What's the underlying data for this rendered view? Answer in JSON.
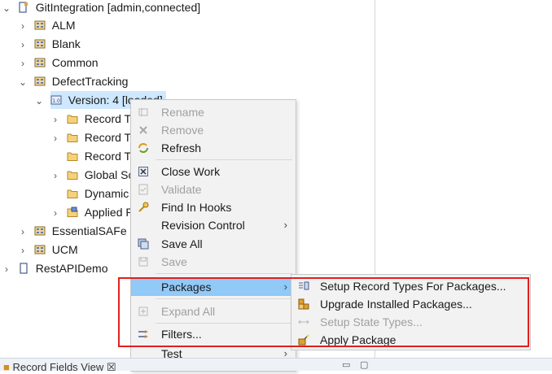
{
  "tree": {
    "root": {
      "label": "GitIntegration [admin,connected]"
    },
    "items": [
      {
        "label": "ALM"
      },
      {
        "label": "Blank"
      },
      {
        "label": "Common"
      },
      {
        "label": "DefectTracking"
      },
      {
        "label": "Version: 4 [loaded]"
      },
      {
        "label": "Record Ty"
      },
      {
        "label": "Record Ty"
      },
      {
        "label": "Record Ty"
      },
      {
        "label": "Global Sc"
      },
      {
        "label": "Dynamic"
      },
      {
        "label": "Applied P"
      },
      {
        "label": "EssentialSAFe"
      },
      {
        "label": "UCM"
      },
      {
        "label": "RestAPIDemo"
      }
    ]
  },
  "context_menu": {
    "items": [
      {
        "label": "Rename",
        "enabled": false
      },
      {
        "label": "Remove",
        "enabled": false
      },
      {
        "label": "Refresh",
        "enabled": true
      },
      {
        "label": "Close Work",
        "enabled": true
      },
      {
        "label": "Validate",
        "enabled": false
      },
      {
        "label": "Find In Hooks",
        "enabled": true
      },
      {
        "label": "Revision Control",
        "enabled": true,
        "submenu": true
      },
      {
        "label": "Save All",
        "enabled": true
      },
      {
        "label": "Save",
        "enabled": false
      },
      {
        "label": "Packages",
        "enabled": true,
        "submenu": true,
        "highlighted": true
      },
      {
        "label": "Expand All",
        "enabled": false
      },
      {
        "label": "Filters...",
        "enabled": true
      },
      {
        "label": "Test",
        "enabled": true,
        "submenu": true
      }
    ]
  },
  "packages_submenu": {
    "items": [
      {
        "label": "Setup Record Types For Packages...",
        "enabled": true
      },
      {
        "label": "Upgrade Installed Packages...",
        "enabled": true
      },
      {
        "label": "Setup State Types...",
        "enabled": false
      },
      {
        "label": "Apply Package",
        "enabled": true
      }
    ]
  },
  "bottom_panel": {
    "tab_label": "Record Fields View",
    "close_glyph": "☒"
  },
  "colors": {
    "highlight": "#91c9f7",
    "selection": "#cde8ff",
    "annotation": "#e02020"
  }
}
